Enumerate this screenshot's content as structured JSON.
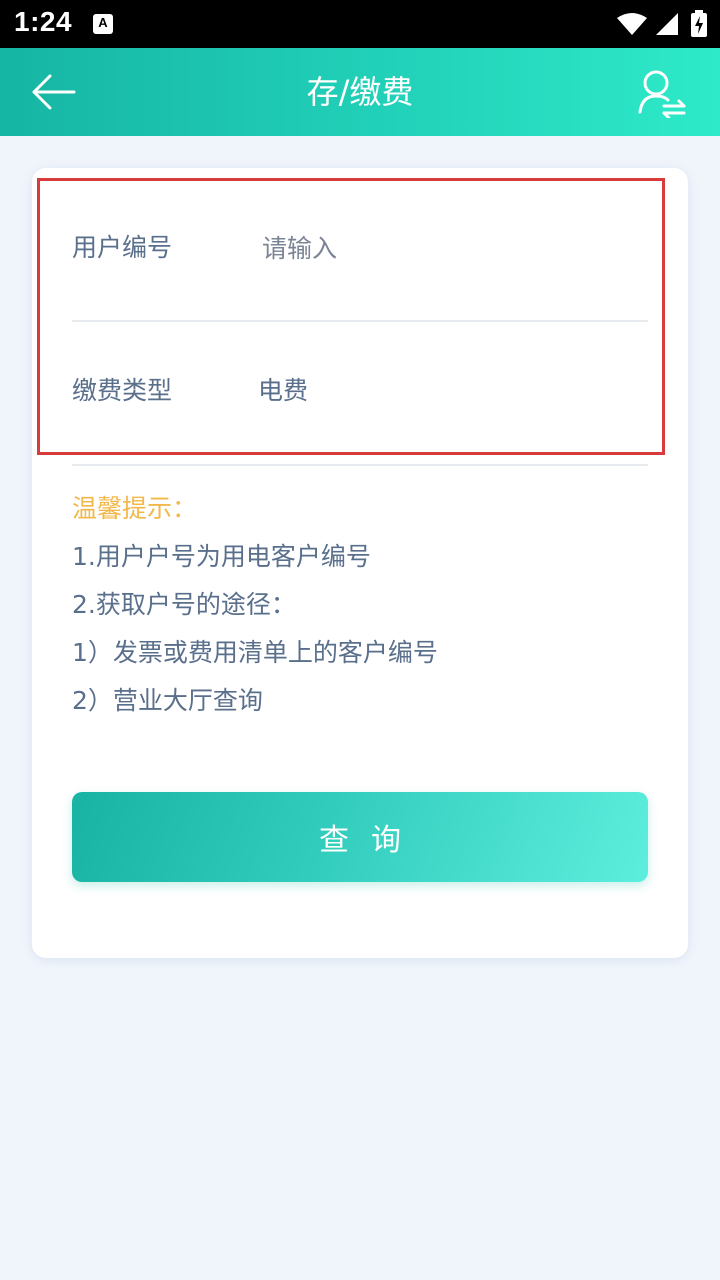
{
  "status_bar": {
    "time": "1:24",
    "notification_badge": "A",
    "icons": [
      "wifi-icon",
      "signal-icon",
      "battery-charging-icon"
    ]
  },
  "header": {
    "title": "存/缴费",
    "back_icon": "arrow-left-icon",
    "right_icon": "user-switch-icon"
  },
  "form": {
    "user_number": {
      "label": "用户编号",
      "value": "",
      "placeholder": "请输入"
    },
    "payment_type": {
      "label": "缴费类型",
      "value": "电费"
    }
  },
  "tips": {
    "title": "温馨提示：",
    "lines": [
      "1.用户户号为用电客户编号",
      "2.获取户号的途径：",
      "1）发票或费用清单上的客户编号",
      "2）营业大厅查询"
    ]
  },
  "actions": {
    "query_label": "查询"
  },
  "colors": {
    "header_gradient_start": "#16b5a4",
    "header_gradient_end": "#2eeac8",
    "tips_title": "#f2b84a",
    "text": "#5a6f8c",
    "highlight_border": "#d83b3b"
  }
}
